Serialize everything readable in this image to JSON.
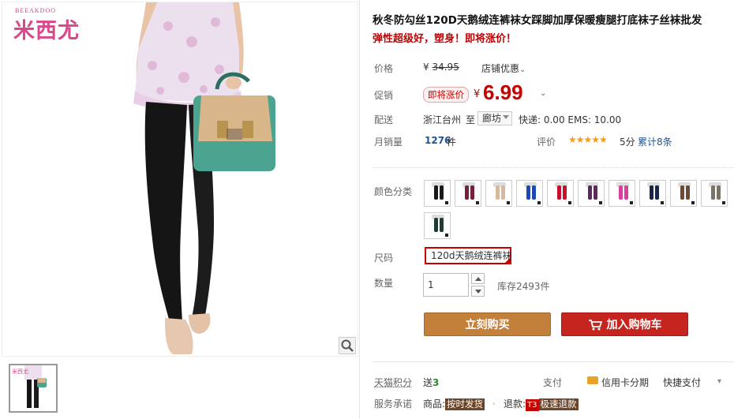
{
  "brand": {
    "top": "BEEAKDOO",
    "name": "米西尤"
  },
  "product": {
    "title": "秋冬防勾丝120D天鹅绒连裤袜女踩脚加厚保暖瘦腿打底袜子丝袜批发",
    "subtitle": "弹性超级好，塑身！即将涨价！"
  },
  "price": {
    "label": "价格",
    "currency": "¥",
    "original": "34.95",
    "shop_discount": "店铺优惠"
  },
  "promo": {
    "label": "促销",
    "badge": "即将涨价",
    "currency": "¥",
    "price": "6.99",
    "caret": "⌄"
  },
  "shipping": {
    "label": "配送",
    "from": "浙江台州",
    "to_word": "至",
    "destination": "廊坊",
    "fees": "快递: 0.00 EMS: 10.00"
  },
  "sales": {
    "label": "月销量",
    "count": "1276",
    "unit": "件",
    "rating_label": "评价",
    "stars_text": "★★★★★",
    "stars": 5,
    "score": "5分",
    "reviews": "累计8条"
  },
  "colors": {
    "label": "颜色分类",
    "swatches": [
      {
        "name": "black",
        "color": "#1a1a1a"
      },
      {
        "name": "wine",
        "color": "#7a1f3a"
      },
      {
        "name": "skin",
        "color": "#d9b79a"
      },
      {
        "name": "blue",
        "color": "#1e49b5"
      },
      {
        "name": "red",
        "color": "#c8102e"
      },
      {
        "name": "purple",
        "color": "#5a2a5a"
      },
      {
        "name": "pink",
        "color": "#d8409a"
      },
      {
        "name": "navy",
        "color": "#1b2545"
      },
      {
        "name": "coffee",
        "color": "#6b4b35"
      },
      {
        "name": "grey",
        "color": "#7d7268"
      },
      {
        "name": "dark-green",
        "color": "#1d3b33"
      }
    ]
  },
  "size": {
    "label": "尺码",
    "selected": "120d天鹅绒连裤袜"
  },
  "quantity": {
    "label": "数量",
    "value": "1",
    "stock": "库存2493件"
  },
  "buttons": {
    "buy_now": "立刻购买",
    "add_to_cart": "加入购物车"
  },
  "points": {
    "label": "天猫积分",
    "prefix": "送",
    "value": "3"
  },
  "payment": {
    "label": "支付",
    "credit": "信用卡分期",
    "quick": "快捷支付",
    "caret": "▾"
  },
  "service": {
    "label": "服务承诺",
    "goods_label": "商品:",
    "goods_tag": "按时发货",
    "sep": "·",
    "refund_label": "退款:",
    "refund_badge": "T3",
    "refund_tag": "极速退款"
  },
  "colors_ui": {
    "price_red": "#c40000",
    "link_blue": "#1e5494",
    "buy_orange": "#c3803b",
    "cart_red": "#c6251f"
  }
}
